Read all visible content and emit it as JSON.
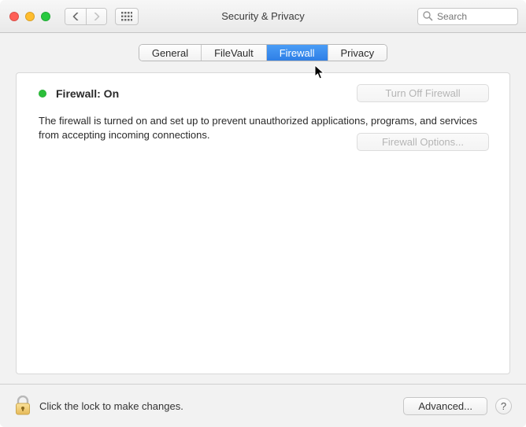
{
  "window": {
    "title": "Security & Privacy"
  },
  "toolbar": {
    "search_placeholder": "Search"
  },
  "tabs": {
    "general": "General",
    "filevault": "FileVault",
    "firewall": "Firewall",
    "privacy": "Privacy",
    "active": "firewall"
  },
  "firewall": {
    "status_label": "Firewall: On",
    "turn_off_label": "Turn Off Firewall",
    "description": "The firewall is turned on and set up to prevent unauthorized applications, programs, and services from accepting incoming connections.",
    "options_label": "Firewall Options..."
  },
  "footer": {
    "lock_text": "Click the lock to make changes.",
    "advanced_label": "Advanced...",
    "help_label": "?"
  },
  "colors": {
    "accent": "#2f7fe6",
    "status_on": "#2bbf3a"
  }
}
